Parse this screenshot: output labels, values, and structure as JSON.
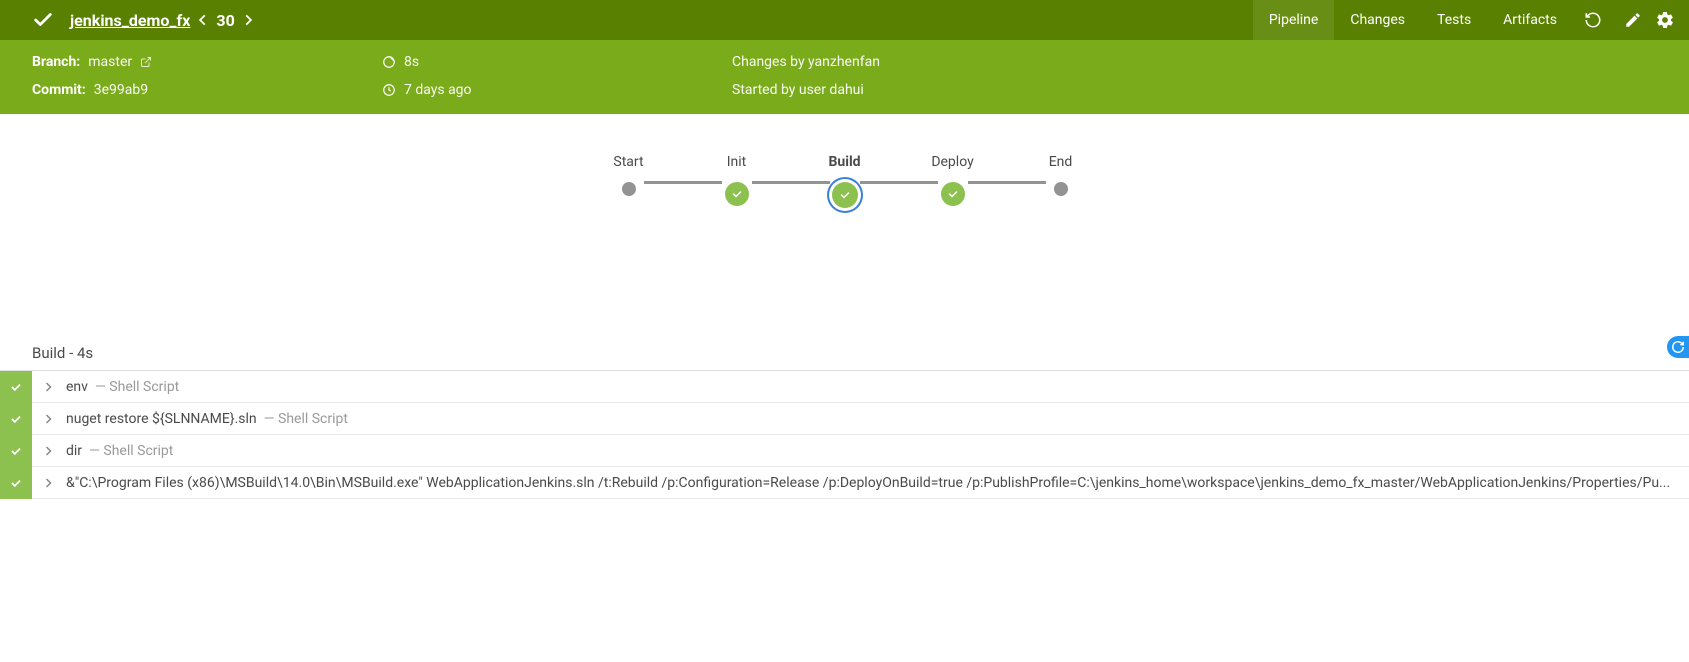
{
  "header": {
    "project": "jenkins_demo_fx",
    "run_number": "30",
    "tabs": {
      "pipeline": "Pipeline",
      "changes": "Changes",
      "tests": "Tests",
      "artifacts": "Artifacts"
    }
  },
  "info": {
    "branch_label": "Branch:",
    "branch_value": "master",
    "commit_label": "Commit:",
    "commit_value": "3e99ab9",
    "duration": "8s",
    "time_ago": "7 days ago",
    "changes_by": "Changes by yanzhenfan",
    "started_by": "Started by user dahui"
  },
  "pipeline": {
    "stages": [
      {
        "name": "Start",
        "type": "terminal"
      },
      {
        "name": "Init",
        "type": "success"
      },
      {
        "name": "Build",
        "type": "success",
        "selected": true
      },
      {
        "name": "Deploy",
        "type": "success"
      },
      {
        "name": "End",
        "type": "terminal"
      }
    ]
  },
  "stage_detail": {
    "title": "Build - 4s",
    "steps": [
      {
        "cmd": "env",
        "meta": "Shell Script"
      },
      {
        "cmd": "nuget restore ${SLNNAME}.sln",
        "meta": "Shell Script"
      },
      {
        "cmd": "dir",
        "meta": "Shell Script"
      },
      {
        "cmd": "&\"C:\\Program Files (x86)\\MSBuild\\14.0\\Bin\\MSBuild.exe\" WebApplicationJenkins.sln /t:Rebuild /p:Configuration=Release /p:DeployOnBuild=true /p:PublishProfile=C:\\jenkins_home\\workspace\\jenkins_demo_fx_master/WebApplicationJenkins/Properties/Pu...",
        "meta": ""
      }
    ]
  }
}
